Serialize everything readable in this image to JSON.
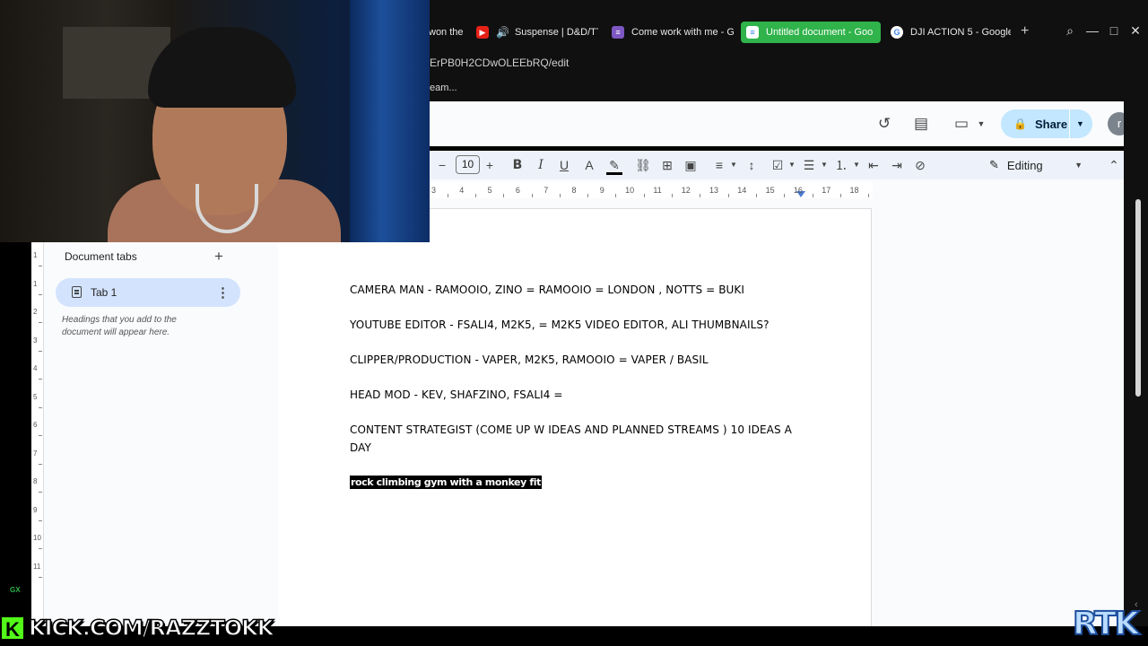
{
  "browser": {
    "tabs": [
      {
        "label": "won the",
        "favicon": "",
        "active": false
      },
      {
        "label": "Suspense | D&D/TTI",
        "favicon": "youtube-icon",
        "active": false
      },
      {
        "label": "Come work with me - G",
        "favicon": "forms-icon",
        "active": false
      },
      {
        "label": "Untitled document - Goo",
        "favicon": "docs-icon",
        "active": true
      },
      {
        "label": "DJI ACTION 5 - Google",
        "favicon": "google-icon",
        "active": false
      }
    ],
    "url": "ErPB0H2CDwOLEEbRQ/edit",
    "bookmark_label": "eam...",
    "accent": "#2fb34a"
  },
  "docs": {
    "share_label": "Share",
    "avatar_letter": "r",
    "font_size": "10",
    "mode_label": "Editing",
    "ruler_numbers": [
      "3",
      "4",
      "5",
      "6",
      "7",
      "8",
      "9",
      "10",
      "11",
      "12",
      "13",
      "14",
      "15",
      "16",
      "17",
      "18"
    ],
    "vruler_numbers": [
      "1",
      "1",
      "2",
      "3",
      "4",
      "5",
      "6",
      "7",
      "8",
      "9",
      "10",
      "11"
    ],
    "sidebar": {
      "title": "Document tabs",
      "tab_label": "Tab 1",
      "help_text": "Headings that you add to the document will appear here."
    },
    "body": [
      "CAMERA MAN - RAMOOIO, ZINO = RAMOOIO = LONDON , NOTTS = BUKI",
      "YOUTUBE EDITOR - FSALI4, M2K5, = M2K5 VIDEO EDITOR, ALI THUMBNAILS?",
      "CLIPPER/PRODUCTION  - VAPER, M2K5, RAMOOIO = VAPER / BASIL",
      "HEAD MOD -  KEV, SHAFZINO, FSALI4  =",
      "CONTENT STRATEGIST (COME UP W IDEAS AND PLANNED STREAMS ) 10 IDEAS A DAY"
    ],
    "highlighted_text": "rock climbing gym with a monkey fit"
  },
  "overlay": {
    "kick_badge": "K",
    "kick_url": "KICK.COM/RAZZTOKK",
    "brand_left": "GX",
    "brand_right": "RTK"
  }
}
